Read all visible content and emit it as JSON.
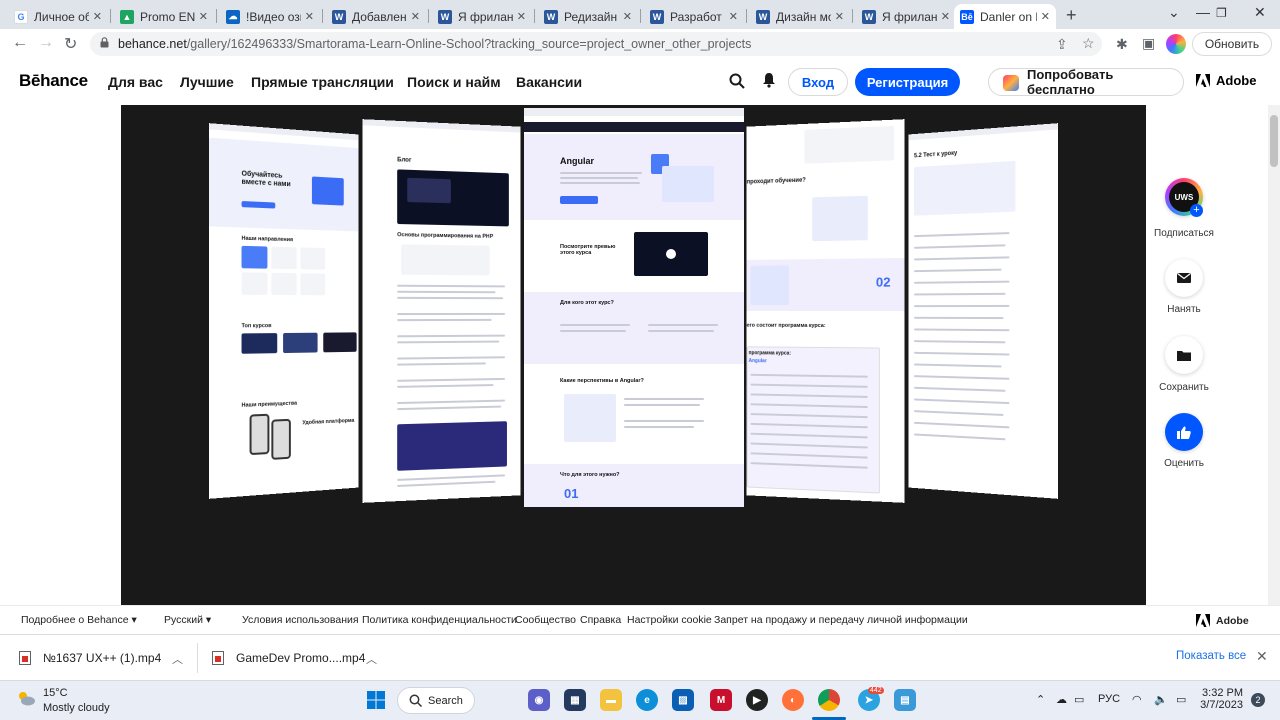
{
  "browser": {
    "tabs": [
      {
        "label": "Личное об",
        "favicon": "google-icon",
        "color": "#4285f4"
      },
      {
        "label": "Promo ENG",
        "favicon": "drive-icon",
        "color": "#1fa463"
      },
      {
        "label": "!Видео озв",
        "favicon": "cloud-icon",
        "color": "#0a66c2"
      },
      {
        "label": "Добавлени",
        "favicon": "word-icon",
        "color": "#2b579a"
      },
      {
        "label": "Я фриланс",
        "favicon": "word-icon",
        "color": "#2b579a"
      },
      {
        "label": "Редизайн б",
        "favicon": "word-icon",
        "color": "#2b579a"
      },
      {
        "label": "Разработ",
        "favicon": "word-icon",
        "color": "#2b579a"
      },
      {
        "label": "Дизайн мо",
        "favicon": "word-icon",
        "color": "#2b579a"
      },
      {
        "label": "Я фриланс",
        "favicon": "word-icon",
        "color": "#2b579a"
      },
      {
        "label": "Danler on E",
        "favicon": "behance-icon",
        "color": "#0057ff",
        "active": true
      }
    ],
    "url_main": "behance.net",
    "url_rest": "/gallery/162496333/Smartorama-Learn-Online-School?tracking_source=project_owner_other_projects",
    "update_label": "Обновить"
  },
  "header": {
    "logo": "Bēhance",
    "nav": [
      "Для вас",
      "Лучшие",
      "Прямые трансляции",
      "Поиск и найм",
      "Вакансии"
    ],
    "login": "Вход",
    "register": "Регистрация",
    "try_free": "Попробовать бесплатно",
    "adobe": "Adobe",
    "brand_color": "#0057ff"
  },
  "rail": {
    "avatar_text": "UWS",
    "subscribe": "Подписаться",
    "hire": "Нанять",
    "save": "Сохранить",
    "rate": "Оценить"
  },
  "footer": {
    "more": "Подробнее о Behance",
    "language": "Русский",
    "links": [
      "Условия использования",
      "Политика конфиденциальности",
      "Сообщество",
      "Справка",
      "Настройки cookie",
      "Запрет на продажу и передачу личной информации"
    ],
    "adobe": "Adobe"
  },
  "downloads": {
    "items": [
      "№1637 UX++ (1).mp4",
      "GameDev Promo....mp4"
    ],
    "show_all": "Показать все"
  },
  "taskbar": {
    "temp": "15°C",
    "weather": "Mostly cloudy",
    "search": "Search",
    "lang": "РУС",
    "time": "3:32 PM",
    "date": "3/7/2023",
    "notifications": "2",
    "telegram_badge": "442"
  },
  "showcase": {
    "center_title": "Angular",
    "center_sub1": "Посмотрите превью этого курса",
    "center_sub2": "Для кого этот курс?",
    "center_sub3": "Какие перспективы в Angular?",
    "center_sub4": "Что для этого нужно?",
    "center_num": "01",
    "left_title": "Обучайтесь вместе с нами",
    "left_sec1": "Наши направления",
    "left_sec2": "Топ курсов",
    "left_sec3": "Наши преимущества",
    "left_sec4": "Удобная платформа",
    "blog_title": "Блог",
    "blog_heading": "Основы программирования на PHP",
    "right_q": "проходит обучение?",
    "right_num": "02",
    "right_prog": "его состоит программа курса:",
    "right_prog2": "программа курса:",
    "right_course": "Angular",
    "far_right_title": "5.2 Тест к уроку"
  }
}
